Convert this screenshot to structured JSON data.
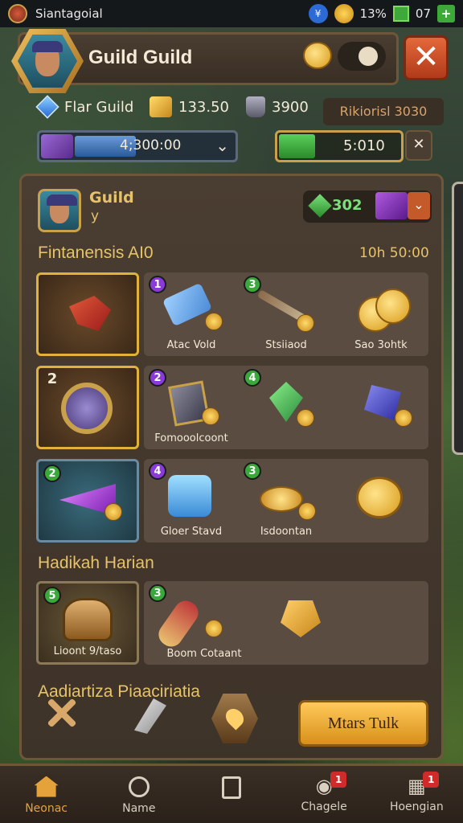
{
  "status_bar": {
    "carrier": "Siantagoial",
    "blue_icon": "¥",
    "battery": "13%",
    "signal": "07"
  },
  "header": {
    "title": "Guild Guild",
    "close_icon": "close-icon"
  },
  "resources": {
    "guild_name": "Flar Guild",
    "gold": "133.50",
    "bag": "3900",
    "right_label": "Rikiorisl 3030",
    "bar1_value": "4;300:00",
    "bar1_fill": 0.38,
    "bar2_value": "5:010",
    "bar2_fill": 0.3
  },
  "guild": {
    "label": "Guild",
    "sub": "y",
    "currency_value": "302"
  },
  "sections": {
    "section1_title": "Fintanensis AI0",
    "section1_time": "10h 50:00",
    "section2_title": "Hadikah Harian",
    "section3_title": "Aadiartiza Piaaciriatia"
  },
  "rows": [
    {
      "big_badge": "",
      "items": [
        {
          "badge": "1",
          "badge_color": "purple",
          "label": "Atac Vold"
        },
        {
          "badge": "3",
          "badge_color": "green",
          "label": "Stsiiaod"
        },
        {
          "badge": "",
          "badge_color": "",
          "label": "Sao 3ohtk"
        }
      ]
    },
    {
      "big_badge": "2",
      "items": [
        {
          "badge": "2",
          "badge_color": "purple",
          "label": "Fomooolcoont"
        },
        {
          "badge": "4",
          "badge_color": "green",
          "label": ""
        },
        {
          "badge": "",
          "badge_color": "",
          "label": ""
        }
      ]
    },
    {
      "big_badge": "2",
      "items": [
        {
          "badge": "4",
          "badge_color": "purple",
          "label": "Gloer Stavd"
        },
        {
          "badge": "3",
          "badge_color": "green",
          "label": "Isdoontan"
        },
        {
          "badge": "",
          "badge_color": "",
          "label": ""
        }
      ]
    }
  ],
  "daily": {
    "item1_badge": "5",
    "item1_label": "Lioont 9/taso",
    "item2_badge": "3",
    "item2_label": "Boom Cotaant"
  },
  "cta": {
    "label": "Mtars Tulk"
  },
  "nav": [
    {
      "label": "Neonac",
      "icon": "home-icon",
      "badge": ""
    },
    {
      "label": "Name",
      "icon": "search-icon",
      "badge": ""
    },
    {
      "label": "",
      "icon": "square-icon",
      "badge": ""
    },
    {
      "label": "Chagele",
      "icon": "power-icon",
      "badge": "1"
    },
    {
      "label": "Hoengian",
      "icon": "map-icon",
      "badge": "1"
    }
  ]
}
